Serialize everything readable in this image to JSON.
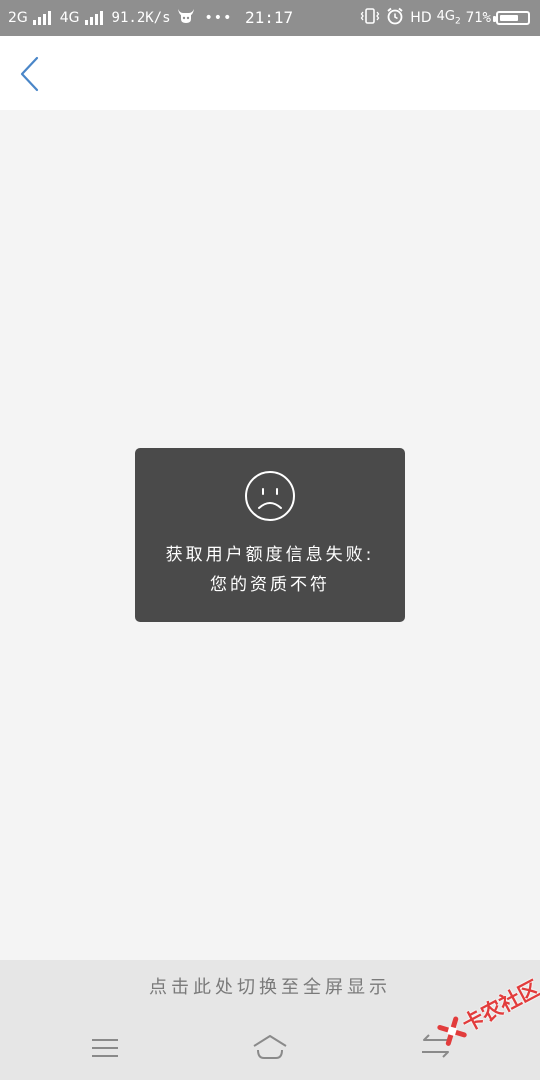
{
  "status_bar": {
    "network_1": "2G",
    "network_2": "4G",
    "speed": "91.2K/s",
    "more": "•••",
    "time": "21:17",
    "hd": "HD",
    "net_right": "4G",
    "net_right_sub": "2",
    "battery_percent": "71%",
    "battery_level": 0.71,
    "icons": [
      "signal-icon",
      "signal-icon",
      "bull-icon",
      "vibrate-icon",
      "alarm-icon",
      "battery-icon"
    ]
  },
  "header": {
    "back_icon": "chevron-left-icon",
    "accent_color": "#4a86c8"
  },
  "toast": {
    "icon": "sad-face-icon",
    "line1": "获取用户额度信息失败:",
    "line2": "您的资质不符",
    "background": "#4a4a4a"
  },
  "bottom": {
    "fullscreen_hint": "点击此处切换至全屏显示",
    "nav_icons": [
      "menu-icon",
      "home-icon",
      "back-icon"
    ]
  },
  "watermark": {
    "text": "卡农社区",
    "color": "#e23c3c"
  }
}
